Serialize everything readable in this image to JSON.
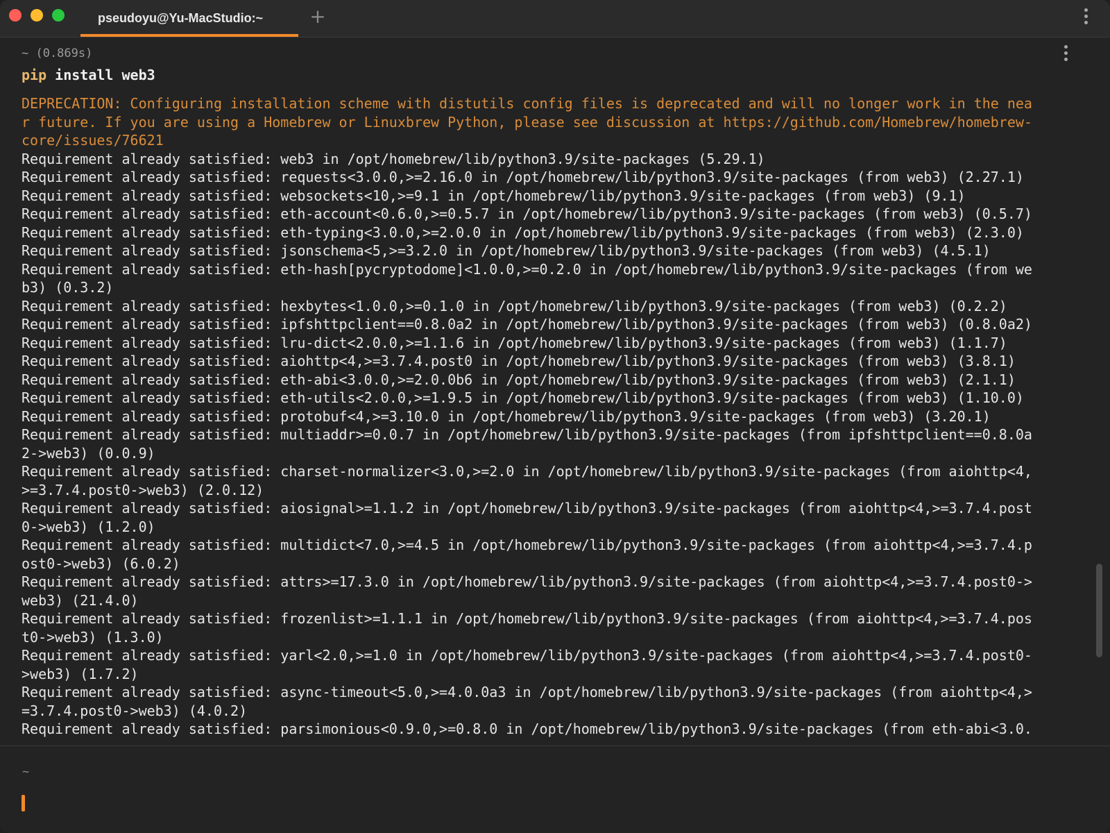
{
  "window": {
    "tab_title": "pseudoyu@Yu-MacStudio:~",
    "new_tab_label": "+"
  },
  "block": {
    "prompt_meta": "~ (0.869s)",
    "command_name": "pip",
    "command_args": " install web3",
    "output_lines": [
      {
        "text": "DEPRECATION: Configuring installation scheme with distutils config files is deprecated and will no longer work in the nea",
        "kind": "warn"
      },
      {
        "text": "r future. If you are using a Homebrew or Linuxbrew Python, please see discussion at https://github.com/Homebrew/homebrew-",
        "kind": "warn"
      },
      {
        "text": "core/issues/76621",
        "kind": "warn"
      },
      {
        "text": "Requirement already satisfied: web3 in /opt/homebrew/lib/python3.9/site-packages (5.29.1)",
        "kind": "normal"
      },
      {
        "text": "Requirement already satisfied: requests<3.0.0,>=2.16.0 in /opt/homebrew/lib/python3.9/site-packages (from web3) (2.27.1)",
        "kind": "normal"
      },
      {
        "text": "Requirement already satisfied: websockets<10,>=9.1 in /opt/homebrew/lib/python3.9/site-packages (from web3) (9.1)",
        "kind": "normal"
      },
      {
        "text": "Requirement already satisfied: eth-account<0.6.0,>=0.5.7 in /opt/homebrew/lib/python3.9/site-packages (from web3) (0.5.7)",
        "kind": "normal"
      },
      {
        "text": "Requirement already satisfied: eth-typing<3.0.0,>=2.0.0 in /opt/homebrew/lib/python3.9/site-packages (from web3) (2.3.0)",
        "kind": "normal"
      },
      {
        "text": "Requirement already satisfied: jsonschema<5,>=3.2.0 in /opt/homebrew/lib/python3.9/site-packages (from web3) (4.5.1)",
        "kind": "normal"
      },
      {
        "text": "Requirement already satisfied: eth-hash[pycryptodome]<1.0.0,>=0.2.0 in /opt/homebrew/lib/python3.9/site-packages (from we",
        "kind": "normal"
      },
      {
        "text": "b3) (0.3.2)",
        "kind": "normal"
      },
      {
        "text": "Requirement already satisfied: hexbytes<1.0.0,>=0.1.0 in /opt/homebrew/lib/python3.9/site-packages (from web3) (0.2.2)",
        "kind": "normal"
      },
      {
        "text": "Requirement already satisfied: ipfshttpclient==0.8.0a2 in /opt/homebrew/lib/python3.9/site-packages (from web3) (0.8.0a2)",
        "kind": "normal"
      },
      {
        "text": "Requirement already satisfied: lru-dict<2.0.0,>=1.1.6 in /opt/homebrew/lib/python3.9/site-packages (from web3) (1.1.7)",
        "kind": "normal"
      },
      {
        "text": "Requirement already satisfied: aiohttp<4,>=3.7.4.post0 in /opt/homebrew/lib/python3.9/site-packages (from web3) (3.8.1)",
        "kind": "normal"
      },
      {
        "text": "Requirement already satisfied: eth-abi<3.0.0,>=2.0.0b6 in /opt/homebrew/lib/python3.9/site-packages (from web3) (2.1.1)",
        "kind": "normal"
      },
      {
        "text": "Requirement already satisfied: eth-utils<2.0.0,>=1.9.5 in /opt/homebrew/lib/python3.9/site-packages (from web3) (1.10.0)",
        "kind": "normal"
      },
      {
        "text": "Requirement already satisfied: protobuf<4,>=3.10.0 in /opt/homebrew/lib/python3.9/site-packages (from web3) (3.20.1)",
        "kind": "normal"
      },
      {
        "text": "Requirement already satisfied: multiaddr>=0.0.7 in /opt/homebrew/lib/python3.9/site-packages (from ipfshttpclient==0.8.0a",
        "kind": "normal"
      },
      {
        "text": "2->web3) (0.0.9)",
        "kind": "normal"
      },
      {
        "text": "Requirement already satisfied: charset-normalizer<3.0,>=2.0 in /opt/homebrew/lib/python3.9/site-packages (from aiohttp<4,",
        "kind": "normal"
      },
      {
        "text": ">=3.7.4.post0->web3) (2.0.12)",
        "kind": "normal"
      },
      {
        "text": "Requirement already satisfied: aiosignal>=1.1.2 in /opt/homebrew/lib/python3.9/site-packages (from aiohttp<4,>=3.7.4.post",
        "kind": "normal"
      },
      {
        "text": "0->web3) (1.2.0)",
        "kind": "normal"
      },
      {
        "text": "Requirement already satisfied: multidict<7.0,>=4.5 in /opt/homebrew/lib/python3.9/site-packages (from aiohttp<4,>=3.7.4.p",
        "kind": "normal"
      },
      {
        "text": "ost0->web3) (6.0.2)",
        "kind": "normal"
      },
      {
        "text": "Requirement already satisfied: attrs>=17.3.0 in /opt/homebrew/lib/python3.9/site-packages (from aiohttp<4,>=3.7.4.post0->",
        "kind": "normal"
      },
      {
        "text": "web3) (21.4.0)",
        "kind": "normal"
      },
      {
        "text": "Requirement already satisfied: frozenlist>=1.1.1 in /opt/homebrew/lib/python3.9/site-packages (from aiohttp<4,>=3.7.4.pos",
        "kind": "normal"
      },
      {
        "text": "t0->web3) (1.3.0)",
        "kind": "normal"
      },
      {
        "text": "Requirement already satisfied: yarl<2.0,>=1.0 in /opt/homebrew/lib/python3.9/site-packages (from aiohttp<4,>=3.7.4.post0-",
        "kind": "normal"
      },
      {
        "text": ">web3) (1.7.2)",
        "kind": "normal"
      },
      {
        "text": "Requirement already satisfied: async-timeout<5.0,>=4.0.0a3 in /opt/homebrew/lib/python3.9/site-packages (from aiohttp<4,>",
        "kind": "normal"
      },
      {
        "text": "=3.7.4.post0->web3) (4.0.2)",
        "kind": "normal"
      },
      {
        "text": "Requirement already satisfied: parsimonious<0.9.0,>=0.8.0 in /opt/homebrew/lib/python3.9/site-packages (from eth-abi<3.0.",
        "kind": "normal"
      }
    ]
  },
  "input": {
    "directory": "~"
  },
  "colors": {
    "accent": "#f28a2b",
    "warning_text": "#d98c3a",
    "command_name": "#e8b86d",
    "background": "#232323"
  },
  "icons": [
    "close-dot-icon",
    "minimize-dot-icon",
    "zoom-dot-icon",
    "plus-icon",
    "kebab-menu-icon"
  ]
}
